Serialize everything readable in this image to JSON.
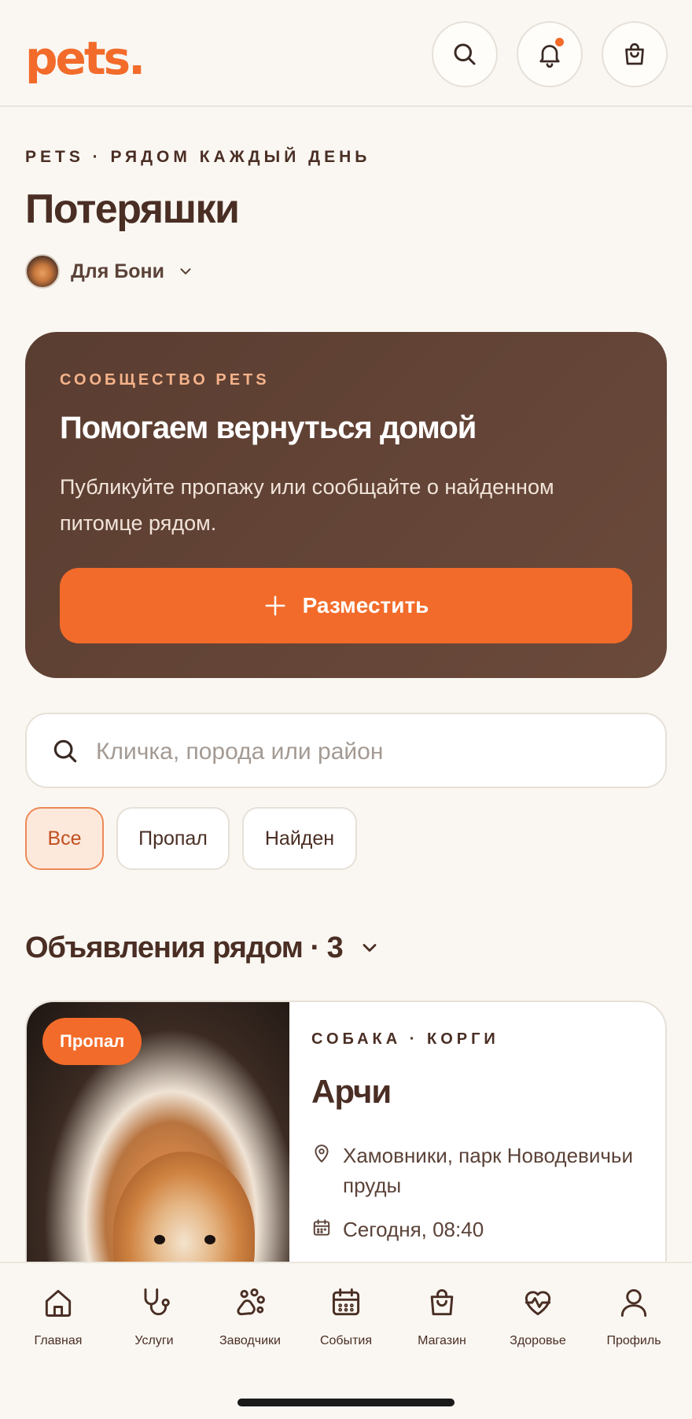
{
  "header": {
    "logo": "pets.",
    "search_icon": "search-icon",
    "notifications_icon": "bell-icon",
    "cart_icon": "shopping-bag-icon",
    "notification_dot_color": "#f26b2a"
  },
  "page": {
    "eyebrow": "PETS · РЯДОМ КАЖДЫЙ ДЕНЬ",
    "title": "Потеряшки",
    "pet_selector": "Для Бони"
  },
  "hero": {
    "eyebrow": "СООБЩЕСТВО PETS",
    "title": "Помогаем вернуться домой",
    "text": "Публикуйте пропажу или сообщайте о найденном питомце рядом.",
    "button_label": "Разместить"
  },
  "search": {
    "placeholder": "Кличка, порода или район",
    "value": ""
  },
  "filters": {
    "all": "Все",
    "lost": "Пропал",
    "found": "Найден",
    "selected": "Все"
  },
  "listings": {
    "heading": "Объявления рядом · 3",
    "items": [
      {
        "status": "Пропал",
        "breed": "СОБАКА · КОРГИ",
        "name": "Арчи",
        "location": "Хамовники, парк Новодевичьи пруды",
        "time": "Сегодня, 08:40"
      }
    ]
  },
  "nav": {
    "home": "Главная",
    "services": "Услуги",
    "breeders": "Заводчики",
    "events": "События",
    "shop": "Магазин",
    "health": "Здоровье",
    "profile": "Профиль"
  },
  "colors": {
    "accent": "#f26b2a",
    "brown": "#4a2e24",
    "hero_bg": "#5a3d31",
    "background": "#faf7f2"
  }
}
